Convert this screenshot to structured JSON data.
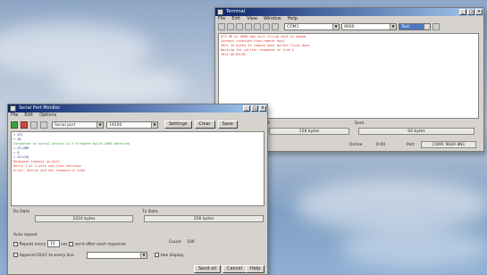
{
  "win_back": {
    "title": "Terminal",
    "menu": [
      "File",
      "Edit",
      "View",
      "Window",
      "Help"
    ],
    "port_select": "COM1",
    "baud_select": "9600",
    "mode_select": "Text",
    "log_lines": [
      {
        "text": "ATZ OK at 9600 bps init string sent to modem",
        "color": "#d83a2c"
      },
      {
        "text": "Connect received from remote host",
        "color": "#d83a2c"
      },
      {
        "text": "Sent 14 bytes to remote host buffer flush done",
        "color": "#d83a2c"
      },
      {
        "text": "Waiting for carrier response on line 2",
        "color": "#d83a2c"
      },
      {
        "text": "Idle  00:00:02",
        "color": "#d83a2c"
      }
    ],
    "status": {
      "left_label": "Received",
      "left_value": "128 bytes",
      "right_label": "Sent",
      "right_value": "64 bytes",
      "online_label": "Online",
      "online_value": "0:00",
      "counter_label": "Port",
      "counter_value": "COM1 9600 8N1"
    }
  },
  "win_front": {
    "title": "Serial Port Monitor",
    "menu": [
      "File",
      "Edit",
      "Options"
    ],
    "port_select": "Serial port",
    "baud_select": "19200",
    "btn_settings": "Settings",
    "btn_clear": "Clear",
    "btn_save": "Save",
    "log_lines": [
      {
        "text": "> ATI",
        "color": "#3a3a9a"
      },
      {
        "text": "< OK",
        "color": "#3a3a9a"
      },
      {
        "text": "Connected to serial device v1.2 firmware build 2004 detected",
        "color": "#3a9a3a"
      },
      {
        "text": "> AT+GMR",
        "color": "#3a3a9a"
      },
      {
        "text": "< 0",
        "color": "#3a3a9a"
      },
      {
        "text": "",
        "color": "#222"
      },
      {
        "text": "> AT+CSQ",
        "color": "#3a3a9a"
      },
      {
        "text": "Response timeout on port",
        "color": "#d83a2c"
      },
      {
        "text": "Retry 1 of 3 with new line settings",
        "color": "#d83a2c"
      },
      {
        "text": "Error: device did not respond in time",
        "color": "#d83a2c"
      }
    ],
    "rx_label": "Rx Data",
    "rx_value": "1024 bytes",
    "tx_label": "Tx Data",
    "tx_value": "256 bytes",
    "auto_label": "Auto repeat",
    "interval_label": "Repeat every",
    "interval_value": "10",
    "interval_unit": "sec",
    "send_cmd": "send after each response",
    "count_label": "Count",
    "count_value": "100",
    "append_label": "Append CR/LF to every line",
    "hex_label": "Hex display",
    "btn_send": "Send all",
    "btn_cancel": "Cancel",
    "btn_help": "Help"
  }
}
